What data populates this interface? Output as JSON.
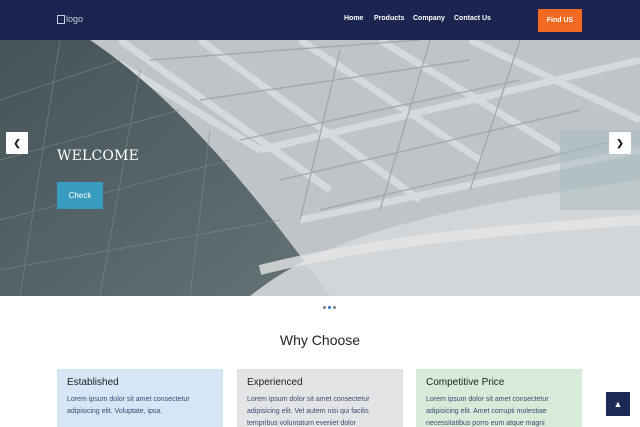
{
  "header": {
    "logo_text": "logo",
    "nav": [
      {
        "label": "Home"
      },
      {
        "label": "Products"
      },
      {
        "label": "Company"
      },
      {
        "label": "Contact Us"
      }
    ],
    "cta_label": "Find US"
  },
  "hero": {
    "title": "WELCOME",
    "button_label": "Check",
    "prev_icon": "chevron-left-icon",
    "next_icon": "chevron-right-icon",
    "slides_count": 3,
    "active_slide": 2
  },
  "section": {
    "title": "Why Choose"
  },
  "cards": [
    {
      "title": "Established",
      "text": "Lorem ipsum dolor sit amet consectetur adipisicing elit. Voluptate, ipsa.",
      "color": "#d5e6f7"
    },
    {
      "title": "Experienced",
      "text": "Lorem ipsum dolor sit amet consectetur adipisicing elit. Vel autem nisi qui facilis tempribus voluntatum eveniet dolor",
      "color": "#e3e4e6"
    },
    {
      "title": "Competitive Price",
      "text": "Lorem ipsum dolor sit amet consectetur adipisicing elit. Amet corrupti molestiae necessitatibus porro eum atque magni",
      "color": "#d6ecd9"
    }
  ],
  "scroll_top_icon": "chevron-up-icon",
  "colors": {
    "header_bg": "#1b2550",
    "cta_bg": "#f26a22",
    "hero_button_bg": "#3a9bc0",
    "scroll_top_bg": "#1b2a55"
  }
}
